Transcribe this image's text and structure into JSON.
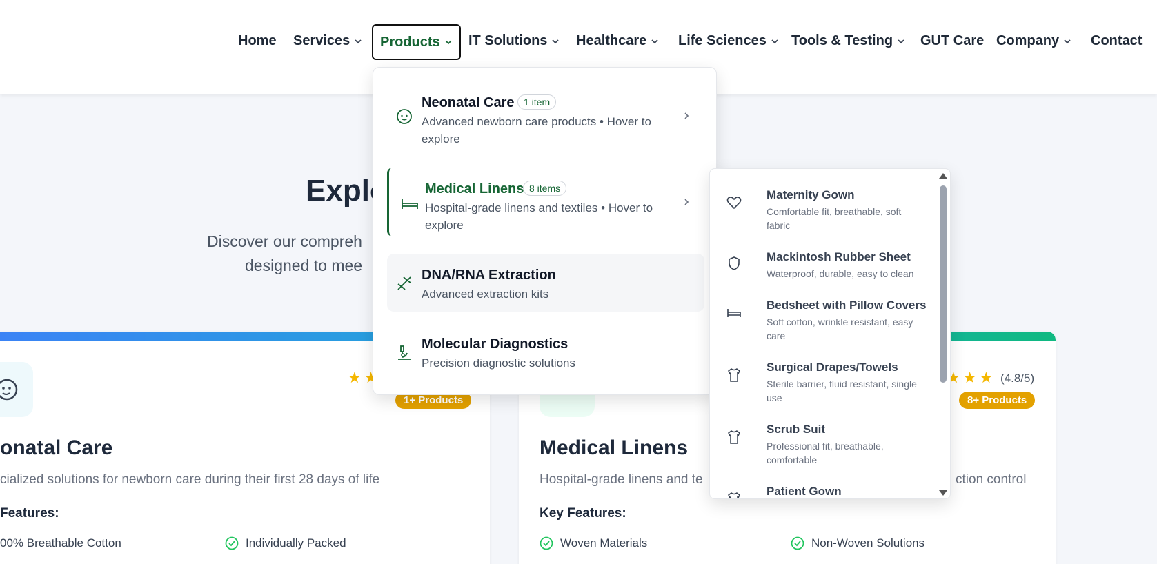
{
  "nav": {
    "items": [
      {
        "label": "Home"
      },
      {
        "label": "Services"
      },
      {
        "label": "Products"
      },
      {
        "label": "IT Solutions"
      },
      {
        "label": "Healthcare"
      },
      {
        "label": "Life Sciences"
      },
      {
        "label": "Tools & Testing"
      },
      {
        "label": "GUT Care"
      },
      {
        "label": "Company"
      },
      {
        "label": "Contact"
      }
    ]
  },
  "hero": {
    "title_visible": "Explo",
    "subtitle_line1": "Discover our compreh",
    "subtitle_line2": "designed to mee"
  },
  "cards": [
    {
      "title": "onatal Care",
      "description": "cialized solutions for newborn care during their first 28 days of life",
      "badge": "1+ Products",
      "key_features_label": "Features:",
      "features": [
        "00% Breathable Cotton",
        "Individually Packed"
      ]
    },
    {
      "title": "Medical Linens",
      "description": "Hospital-grade linens and te",
      "description_tail": "ction control",
      "badge": "8+ Products",
      "rating": "(4.8/5)",
      "key_features_label": "Key Features:",
      "features": [
        "Woven Materials",
        "Non-Woven Solutions"
      ]
    }
  ],
  "dropdown": {
    "items": [
      {
        "title": "Neonatal Care",
        "badge": "1 item",
        "desc": "Advanced newborn care products • Hover to explore",
        "icon": "baby-icon"
      },
      {
        "title": "Medical Linens",
        "badge": "8 items",
        "desc": "Hospital-grade linens and textiles • Hover to explore",
        "icon": "bed-icon"
      },
      {
        "title": "DNA/RNA Extraction",
        "desc": "Advanced extraction kits",
        "icon": "dna-icon"
      },
      {
        "title": "Molecular Diagnostics",
        "desc": "Precision diagnostic solutions",
        "icon": "microscope-icon"
      }
    ]
  },
  "submenu": {
    "items": [
      {
        "title": "Maternity Gown",
        "desc": "Comfortable fit, breathable, soft fabric",
        "icon": "heart-icon"
      },
      {
        "title": "Mackintosh Rubber Sheet",
        "desc": "Waterproof, durable, easy to clean",
        "icon": "shield-icon"
      },
      {
        "title": "Bedsheet with Pillow Covers",
        "desc": "Soft cotton, wrinkle resistant, easy care",
        "icon": "bed-icon"
      },
      {
        "title": "Surgical Drapes/Towels",
        "desc": "Sterile barrier, fluid resistant, single use",
        "icon": "shirt-icon"
      },
      {
        "title": "Scrub Suit",
        "desc": "Professional fit, breathable, comfortable",
        "icon": "shirt-icon"
      },
      {
        "title": "Patient Gown",
        "desc": "",
        "icon": "shirt-icon"
      }
    ]
  },
  "colors": {
    "accent_green": "#166534",
    "badge_amber": "#e3a100",
    "star": "#f5b700",
    "check": "#22c55e"
  }
}
